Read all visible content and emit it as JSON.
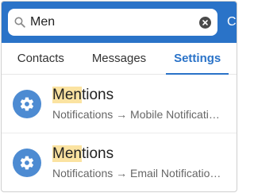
{
  "search": {
    "value": "Men",
    "cancel_label": "Cancel"
  },
  "tabs": [
    {
      "label": "Contacts",
      "active": false
    },
    {
      "label": "Messages",
      "active": false
    },
    {
      "label": "Settings",
      "active": true
    }
  ],
  "results": [
    {
      "title_highlight": "Men",
      "title_rest": "tions",
      "path": "Notifications → Mobile Notificati…",
      "icon": "gear-icon"
    },
    {
      "title_highlight": "Men",
      "title_rest": "tions",
      "path": "Notifications → Email Notificatio…",
      "icon": "gear-icon"
    }
  ],
  "colors": {
    "accent": "#2a73c8",
    "icon_bg": "#4d8bd2",
    "highlight": "#fbe3a1"
  }
}
